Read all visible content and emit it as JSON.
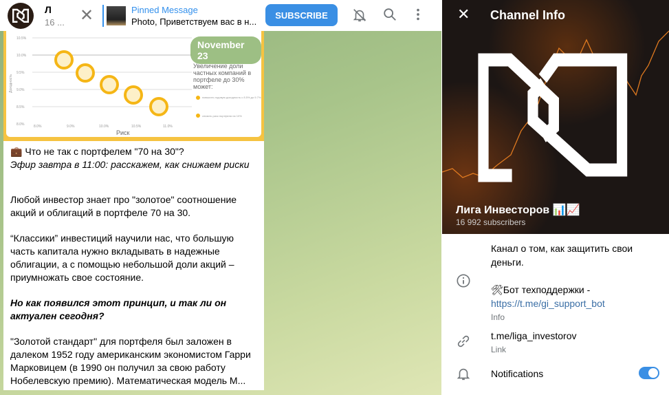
{
  "header": {
    "title": "Л",
    "subtitle": "16 ...",
    "close_icon": "close-icon",
    "pinned_label": "Pinned Message",
    "pinned_text": "Photo, Приветствуем вас в н...",
    "subscribe": "SUBSCRIBE",
    "icons": [
      "bell-off-icon",
      "search-icon",
      "more-vertical-icon"
    ]
  },
  "message": {
    "photo": {
      "date_badge": "November 23",
      "y_axis": "Доходность",
      "x_axis": "Риск",
      "y_ticks": [
        "10.5%",
        "10.0%",
        "9.5%",
        "9.0%",
        "8.5%",
        "8.0%"
      ],
      "x_ticks": [
        "8.0%",
        "9.0%",
        "10.0%",
        "10.5%",
        "11.0%"
      ],
      "notes": [
        "Увеличение доли частных компаний в портфеле до 30% может:",
        "повысить годовую доходность с 8.5% до 9.7%",
        "снизить риск портфеля на 10%"
      ]
    },
    "title": "💼 Что не так с портфелем \"70 на 30\"?",
    "subtitle": "Эфир завтра в 11:00: расскажем, как снижаем риски",
    "p1": "Любой инвестор знает про \"золотое\" соотношение акций и облигаций в портфеле 70 на 30.",
    "p2": "“Классики” инвестиций научили нас, что большую часть капитала нужно вкладывать в надежные облигации, а с помощью небольшой доли акций – приумножать свое состояние.",
    "p3": "Но как появился этот принцип, и так ли он актуален сегодня?",
    "p4": "\"Золотой стандарт\" для портфеля был заложен в далеком 1952 году американским экономистом Гарри Марковицем (в 1990 он получил за свою работу Нобелевскую премию). Математическая модель М..."
  },
  "panel": {
    "title": "Channel Info",
    "name": "Лига Инвесторов 📊📈",
    "subscribers": "16 992 subscribers",
    "info_text": "Канал о том, как защитить свои деньги.",
    "support": "🛠Бот техподдержки -",
    "support_link": "https://t.me/gi_support_bot",
    "info_label": "Info",
    "link": "t.me/liga_investorov",
    "link_label": "Link",
    "notifications": "Notifications",
    "notifications_on": true,
    "accent": "#3a8fe4"
  }
}
